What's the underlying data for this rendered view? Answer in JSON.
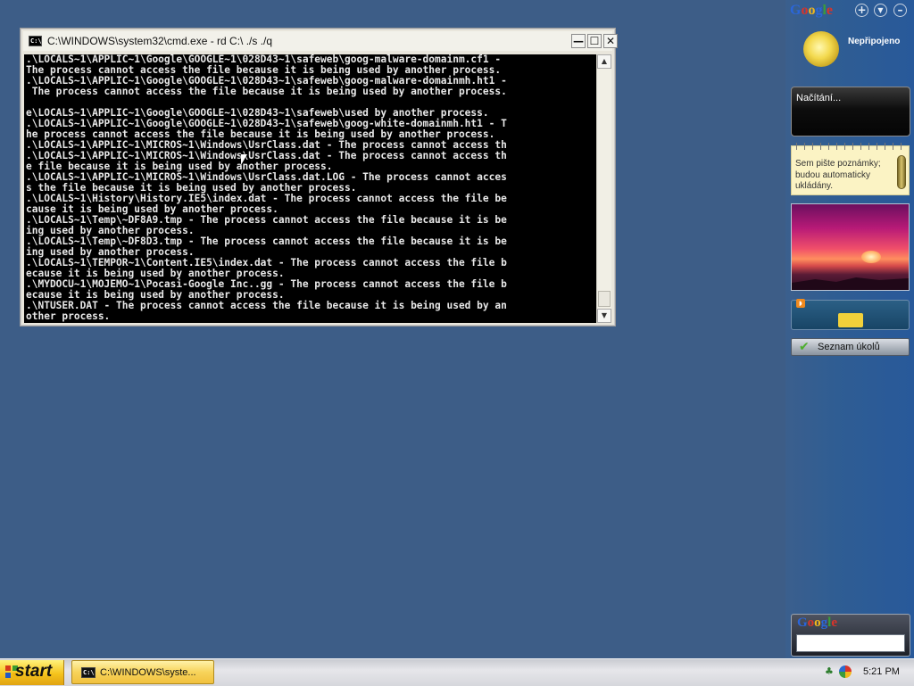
{
  "cmd_window": {
    "title": "C:\\WINDOWS\\system32\\cmd.exe - rd C:\\ ./s ./q",
    "icon_text": "C:\\",
    "min_label": "—",
    "max_label": "☐",
    "close_label": "✕",
    "console_lines": [
      ".\\LOCALS~1\\APPLIC~1\\Google\\GOOGLE~1\\028D43~1\\safeweb\\goog-malware-domainm.cf1 -",
      "The process cannot access the file because it is being used by another process.",
      ".\\LOCALS~1\\APPLIC~1\\Google\\GOOGLE~1\\028D43~1\\safeweb\\goog-malware-domainmh.ht1 -",
      " The process cannot access the file because it is being used by another process.",
      "",
      "e\\LOCALS~1\\APPLIC~1\\Google\\GOOGLE~1\\028D43~1\\safeweb\\used by another process.",
      ".\\LOCALS~1\\APPLIC~1\\Google\\GOOGLE~1\\028D43~1\\safeweb\\goog-white-domainmh.ht1 - T",
      "he process cannot access the file because it is being used by another process.",
      ".\\LOCALS~1\\APPLIC~1\\MICROS~1\\Windows\\UsrClass.dat - The process cannot access th",
      ".\\LOCALS~1\\APPLIC~1\\MICROS~1\\Windows\\UsrClass.dat - The process cannot access th",
      "e file because it is being used by another process.",
      ".\\LOCALS~1\\APPLIC~1\\MICROS~1\\Windows\\UsrClass.dat.LOG - The process cannot acces",
      "s the file because it is being used by another process.",
      ".\\LOCALS~1\\History\\History.IE5\\index.dat - The process cannot access the file be",
      "cause it is being used by another process.",
      ".\\LOCALS~1\\Temp\\~DF8A9.tmp - The process cannot access the file because it is be",
      "ing used by another process.",
      ".\\LOCALS~1\\Temp\\~DF8D3.tmp - The process cannot access the file because it is be",
      "ing used by another process.",
      ".\\LOCALS~1\\TEMPOR~1\\Content.IE5\\index.dat - The process cannot access the file b",
      "ecause it is being used by another process.",
      ".\\MYDOCU~1\\MOJEMO~1\\Pocasi-Google Inc..gg - The process cannot access the file b",
      "ecause it is being used by another process.",
      ".\\NTUSER.DAT - The process cannot access the file because it is being used by an",
      "other process."
    ],
    "scroll_up": "▲",
    "scroll_down": "▼"
  },
  "sidebar": {
    "logo": "Google",
    "add_label": "+",
    "options_label": "▼",
    "minimize_label": "–",
    "weather_status": "Nepřipojeno",
    "news_loading": "Načítání...",
    "notes_text": "Sem pište poznámky; budou automaticky ukládány.",
    "rss_badge": "◗",
    "tasks_label": "Seznam úkolů",
    "tasks_check": "✔",
    "search_logo": "Google",
    "search_value": ""
  },
  "taskbar": {
    "start_label": "start",
    "task_cmd_icon": "C:\\",
    "task_cmd_label": "C:\\WINDOWS\\syste...",
    "clock": "5:21 PM",
    "network_icon": "♣"
  },
  "colors": {
    "desktop": "#3d5d87",
    "console_bg": "#000000",
    "console_text": "#e8e8e8",
    "start_button": "#f5c31c",
    "google_blue": "#2b66d9",
    "google_red": "#d8342a",
    "google_yellow": "#f2b71c",
    "google_green": "#3b9b3b"
  },
  "icons": {
    "cmd_window": "cmd-icon",
    "sun": "weather-sun-icon",
    "tasks": "check-icon",
    "rss": "rss-icon",
    "start": "windows-logo-icon",
    "tray_network": "network-icon",
    "tray_security": "security-icon"
  }
}
